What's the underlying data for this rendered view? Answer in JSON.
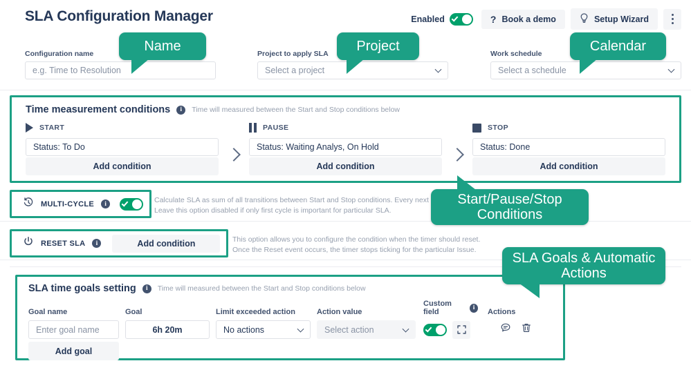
{
  "header": {
    "title": "SLA Configuration Manager",
    "enabled_label": "Enabled",
    "enabled_state": "on",
    "book_demo_label": "Book a demo",
    "book_demo_icon": "question-mark-icon",
    "setup_wizard_label": "Setup Wizard",
    "setup_wizard_icon": "lightbulb-icon",
    "more_icon": "kebab-menu-icon"
  },
  "form": {
    "configuration_name": {
      "label": "Configuration name",
      "placeholder": "e.g. Time to Resolution",
      "value": ""
    },
    "project": {
      "label": "Project to apply SLA",
      "placeholder": "Select a project",
      "value": ""
    },
    "work_schedule": {
      "label": "Work schedule",
      "placeholder": "Select a schedule",
      "value": ""
    }
  },
  "callouts": {
    "name": "Name",
    "project": "Project",
    "calendar": "Calendar",
    "conditions": "Start/Pause/Stop\nConditions",
    "conditions_l1": "Start/Pause/Stop",
    "conditions_l2": "Conditions",
    "goals_l1": "SLA Goals & Automatic",
    "goals_l2": "Actions"
  },
  "time_conditions": {
    "title": "Time measurement conditions",
    "info_icon": "info-icon",
    "subtitle": "Time will measured between the Start and Stop conditions below",
    "columns": [
      {
        "icon": "play-icon",
        "label": "START",
        "value": "Status: To Do",
        "add_label": "Add condition"
      },
      {
        "icon": "pause-icon",
        "label": "PAUSE",
        "value": "Status: Waiting Analys, On Hold",
        "add_label": "Add condition"
      },
      {
        "icon": "stop-icon",
        "label": "STOP",
        "value": "Status: Done",
        "add_label": "Add condition"
      }
    ]
  },
  "multi_cycle": {
    "icon": "history-clock-icon",
    "label": "MULTI-CYCLE",
    "info_icon": "info-icon",
    "toggle_state": "on",
    "desc_line1": "Calculate SLA as sum of all transitions between Start and Stop conditions. Every next cycle starts",
    "desc_line2": "Leave this option disabled if only first cycle is important for particular SLA."
  },
  "reset_sla": {
    "icon": "power-icon",
    "label": "RESET SLA",
    "info_icon": "info-icon",
    "button_label": "Add condition",
    "desc_line1": "This option allows you to configure the condition when the timer should reset.",
    "desc_line2": "Once the Reset event occurs, the timer stops ticking for the particular Issue."
  },
  "goals": {
    "title": "SLA time goals setting",
    "info_icon": "info-icon",
    "subtitle": "Time will measured between the Start and Stop conditions below",
    "headers": {
      "goal_name": "Goal name",
      "goal": "Goal",
      "limit_exceeded_action": "Limit exceeded action",
      "action_value": "Action value",
      "custom_field": "Custom field",
      "custom_field_info_icon": "info-icon",
      "actions": "Actions"
    },
    "row": {
      "goal_name_placeholder": "Enter goal name",
      "goal_name_value": "",
      "goal_value": "6h 20m",
      "limit_exceeded_action": "No actions",
      "action_value_placeholder": "Select action",
      "custom_field_toggle": "on",
      "expand_icon": "expand-icon",
      "comment_icon": "comment-icon",
      "delete_icon": "trash-icon"
    },
    "add_goal_label": "Add goal"
  },
  "colors": {
    "accent": "#1CA085",
    "toggle_on": "#00A06B",
    "text": "#253858",
    "muted": "#97A0AF",
    "field_border": "#DFE1E6",
    "button_bg": "#F4F5F7"
  }
}
